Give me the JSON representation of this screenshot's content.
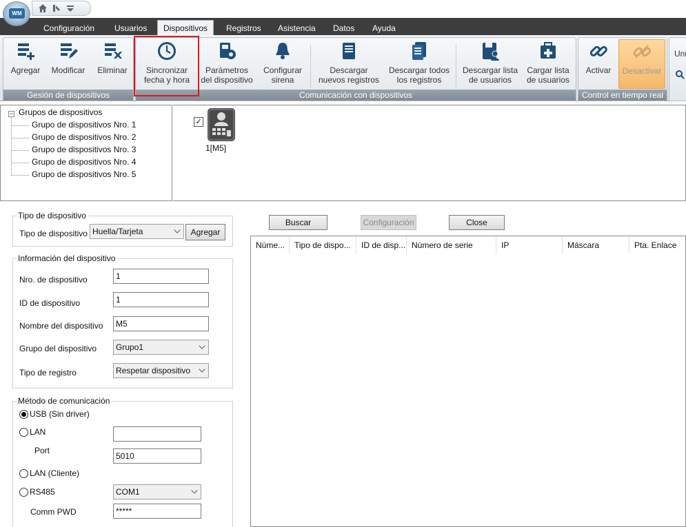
{
  "app": {
    "logo_text": "WM",
    "quick_access": [
      "home-icon",
      "tools-icon",
      "dropdown-icon"
    ]
  },
  "menu": [
    "Configuración",
    "Usuarios",
    "Dispositivos",
    "Registros",
    "Asistencia",
    "Datos",
    "Ayuda"
  ],
  "menu_active": "Dispositivos",
  "ribbon": {
    "gestion": {
      "label": "Gesión de dispositivos",
      "buttons": [
        "Agregar",
        "Modificar",
        "Eliminar"
      ]
    },
    "comunicacion": {
      "label": "Comunicación con dispositivos",
      "sync_line1": "Sincronizar",
      "sync_line2": "fecha y hora",
      "params_line1": "Parámetros",
      "params_line2": "del dispositivo",
      "siren_line1": "Configurar",
      "siren_line2": "sirena",
      "dl_new_line1": "Descargar",
      "dl_new_line2": "nuevos registros",
      "dl_all_line1": "Descargar todos",
      "dl_all_line2": "los registros",
      "dl_users_line1": "Descargar lista",
      "dl_users_line2": "de usuarios",
      "up_users_line1": "Cargar lista",
      "up_users_line2": "de usuarios"
    },
    "control": {
      "label": "Control en tiempo real",
      "activate": "Activar",
      "deactivate": "Desactivar"
    },
    "partial_text": "Uni"
  },
  "tree": {
    "root": "Grupos de dispositivos",
    "children": [
      "Grupo de dispositivos Nro. 1",
      "Grupo de dispositivos Nro. 2",
      "Grupo de dispositivos Nro. 3",
      "Grupo de dispositivos Nro. 4",
      "Grupo de dispositivos Nro. 5"
    ]
  },
  "device": {
    "label": "1[M5]",
    "checked": true
  },
  "tipo": {
    "legend": "Tipo de dispositivo",
    "label": "Tipo de dispositivo",
    "value": "Huella/Tarjeta",
    "add_button": "Agregar"
  },
  "info": {
    "legend": "Información del dispositivo",
    "nro_label": "Nro. de dispositivo",
    "nro_value": "1",
    "id_label": "ID de dispositivo",
    "id_value": "1",
    "name_label": "Nombre del dispositivo",
    "name_value": "M5",
    "group_label": "Grupo del dispositivo",
    "group_value": "Grupo1",
    "reg_label": "Tipo de registro",
    "reg_value": "Respetar dispositivo"
  },
  "comm": {
    "legend": "Método de comunicación",
    "usb": "USB (Sin driver)",
    "lan": "LAN",
    "lan_value": "",
    "port_label": "Port",
    "port_value": "5010",
    "lan_client": "LAN (Cliente)",
    "rs485": "RS485",
    "com_value": "COM1",
    "pwd_label": "Comm PWD",
    "pwd_value": "*****",
    "selected": "usb"
  },
  "search": {
    "buscar": "Buscar",
    "configuracion": "Configuración",
    "close": "Close"
  },
  "table": {
    "headers": [
      "Núme...",
      "Tipo de dispo...",
      "ID de disp...",
      "Número de serie",
      "IP",
      "Máscara",
      "Pta. Enlace"
    ]
  }
}
